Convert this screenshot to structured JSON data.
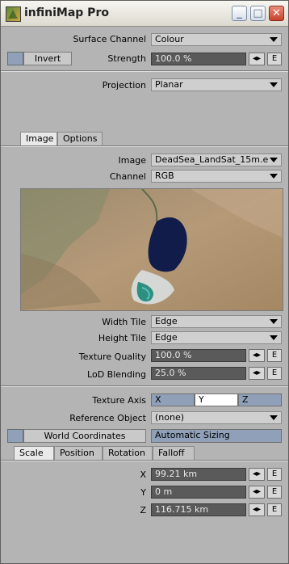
{
  "window": {
    "title": "infiniMap Pro"
  },
  "surface": {
    "channel_label": "Surface Channel",
    "channel_value": "Colour",
    "invert_label": "Invert",
    "strength_label": "Strength",
    "strength_value": "100.0 %",
    "env_label": "E"
  },
  "projection": {
    "label": "Projection",
    "value": "Planar"
  },
  "tabs_top": [
    "Image",
    "Options"
  ],
  "image": {
    "image_label": "Image",
    "image_value": "DeadSea_LandSat_15m.e ...",
    "channel_label": "Channel",
    "channel_value": "RGB",
    "width_tile_label": "Width Tile",
    "width_tile_value": "Edge",
    "height_tile_label": "Height Tile",
    "height_tile_value": "Edge",
    "quality_label": "Texture Quality",
    "quality_value": "100.0 %",
    "lod_label": "LoD Blending",
    "lod_value": "25.0 %"
  },
  "axis": {
    "label": "Texture Axis",
    "options": [
      "X",
      "Y",
      "Z"
    ],
    "selected": "Y",
    "ref_label": "Reference Object",
    "ref_value": "(none)",
    "world_coords_label": "World Coordinates",
    "auto_sizing_label": "Automatic Sizing"
  },
  "tabs_bottom": [
    "Scale",
    "Position",
    "Rotation",
    "Falloff"
  ],
  "scale": {
    "x_label": "X",
    "x_value": "99.21 km",
    "y_label": "Y",
    "y_value": "0 m",
    "z_label": "Z",
    "z_value": "116.715 km"
  },
  "icons": {
    "app": "infinimap-app-icon",
    "minimize": "minimize-icon",
    "maximize": "maximize-icon",
    "close": "close-icon",
    "stepper": "left-right-arrows-icon"
  }
}
